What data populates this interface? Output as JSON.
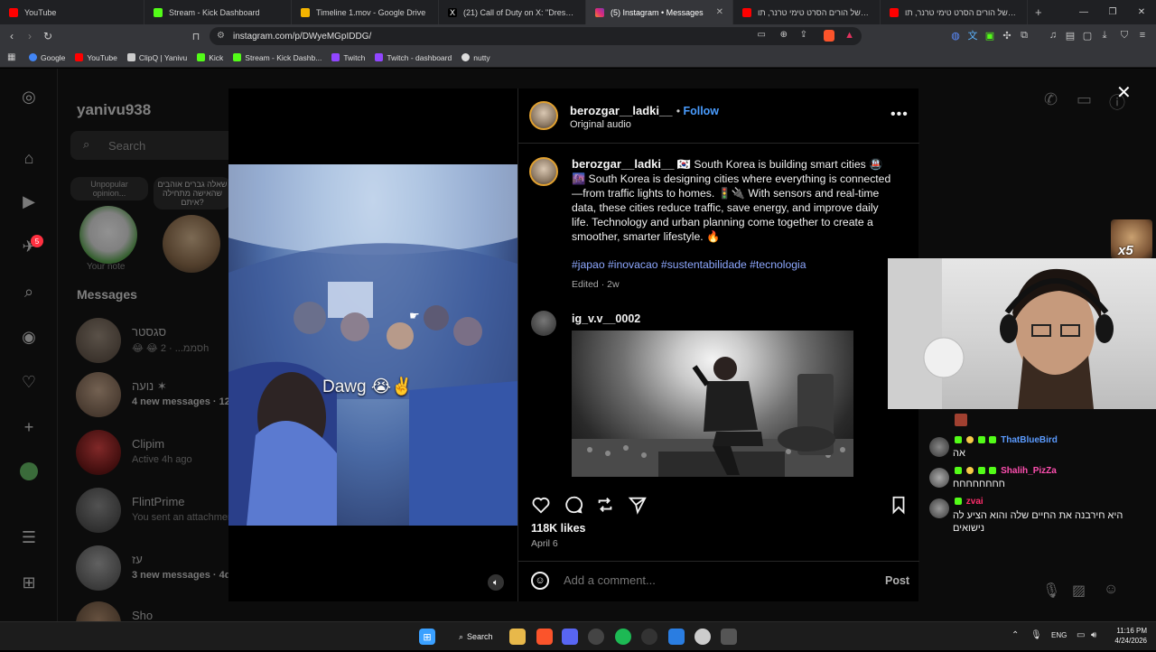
{
  "browser": {
    "tabs": [
      {
        "title": "YouTube",
        "color": "#ff0000",
        "active": false
      },
      {
        "title": "Stream - Kick Dashboard",
        "color": "#53fc18",
        "active": false
      },
      {
        "title": "Timeline 1.mov - Google Drive",
        "color": "#f4b400",
        "active": false
      },
      {
        "title": "(21) Call of Duty on X: \"Dress to flex",
        "color": "#ffffff",
        "active": false
      },
      {
        "title": "(5) Instagram • Messages",
        "color": "#e1306c",
        "active": true
      },
      {
        "title": "קסם של הורים הסרט טימי טרנר, תו",
        "color": "#ff0000",
        "active": false
      },
      {
        "title": "קסם של הורים הסרט טימי טרנר, תו",
        "color": "#ff0000",
        "active": false
      }
    ],
    "url": "instagram.com/p/DWyeMGpIDDG/",
    "bookmarks": [
      {
        "label": "Google",
        "color": "#4285f4"
      },
      {
        "label": "YouTube",
        "color": "#ff0000"
      },
      {
        "label": "ClipQ | Yanivu",
        "color": "#cccccc"
      },
      {
        "label": "Kick",
        "color": "#53fc18"
      },
      {
        "label": "Stream - Kick Dashb...",
        "color": "#53fc18"
      },
      {
        "label": "Twitch",
        "color": "#9146ff"
      },
      {
        "label": "Twitch - dashboard",
        "color": "#9146ff"
      },
      {
        "label": "nutty",
        "color": "#dddddd"
      }
    ]
  },
  "instagram": {
    "username": "yanivu938",
    "search_placeholder": "Search",
    "notes": [
      {
        "text": "Unpopular opinion...",
        "caption": "Your note"
      },
      {
        "text": "שאלה גברים אוהבים שהאישה מתחילה איתם?",
        "caption": ""
      }
    ],
    "messages_heading": "Messages",
    "notification_count": "5",
    "conversations": [
      {
        "name": "סגסטר",
        "sub": "😂 😂 סממ... · 2h"
      },
      {
        "name": "נועה ✶",
        "sub": "4 new messages · 12h",
        "bold": true
      },
      {
        "name": "Clipim",
        "sub": "Active 4h ago"
      },
      {
        "name": "FlintPrime",
        "sub": "You sent an attachment"
      },
      {
        "name": "עז",
        "sub": "3 new messages · 4d",
        "bold": true
      },
      {
        "name": "Sho",
        "sub": ""
      }
    ]
  },
  "post": {
    "author": "berozgar__ladki__",
    "follow_label": "Follow",
    "audio": "Original audio",
    "video_overlay_text": "Dawg 😭✌️",
    "caption": "🇰🇷 South Korea is building smart cities 🚇🌆 South Korea is designing cities where everything is connected—from traffic lights to homes. 🚦🔌 With sensors and real-time data, these cities reduce traffic, save energy, and improve daily life. Technology and urban planning come together to create a smoother, smarter lifestyle. 🔥",
    "hashtags": "#japao #inovacao #sustentabilidade #tecnologia",
    "edited": "Edited · 2w",
    "commenter": "ig_v.v__0002",
    "likes": "118K likes",
    "date": "April 6",
    "comment_placeholder": "Add a comment...",
    "post_label": "Post"
  },
  "stream_chat": {
    "x5_label": "x5",
    "messages": [
      {
        "name": "ThatBlueBird",
        "name_color": "#5b9bff",
        "text": "אה"
      },
      {
        "name": "Shalih_PizZa",
        "name_color": "#ff4fb0",
        "text": "חחחחחחחח"
      },
      {
        "name": "zvai",
        "name_color": "#ff2d6b",
        "text": "היא חירבנה את החיים שלה והוא הציע לה נישואים"
      }
    ]
  },
  "taskbar": {
    "search_label": "Search",
    "language": "ENG",
    "time": "11:16 PM",
    "date": "4/24/2026"
  }
}
